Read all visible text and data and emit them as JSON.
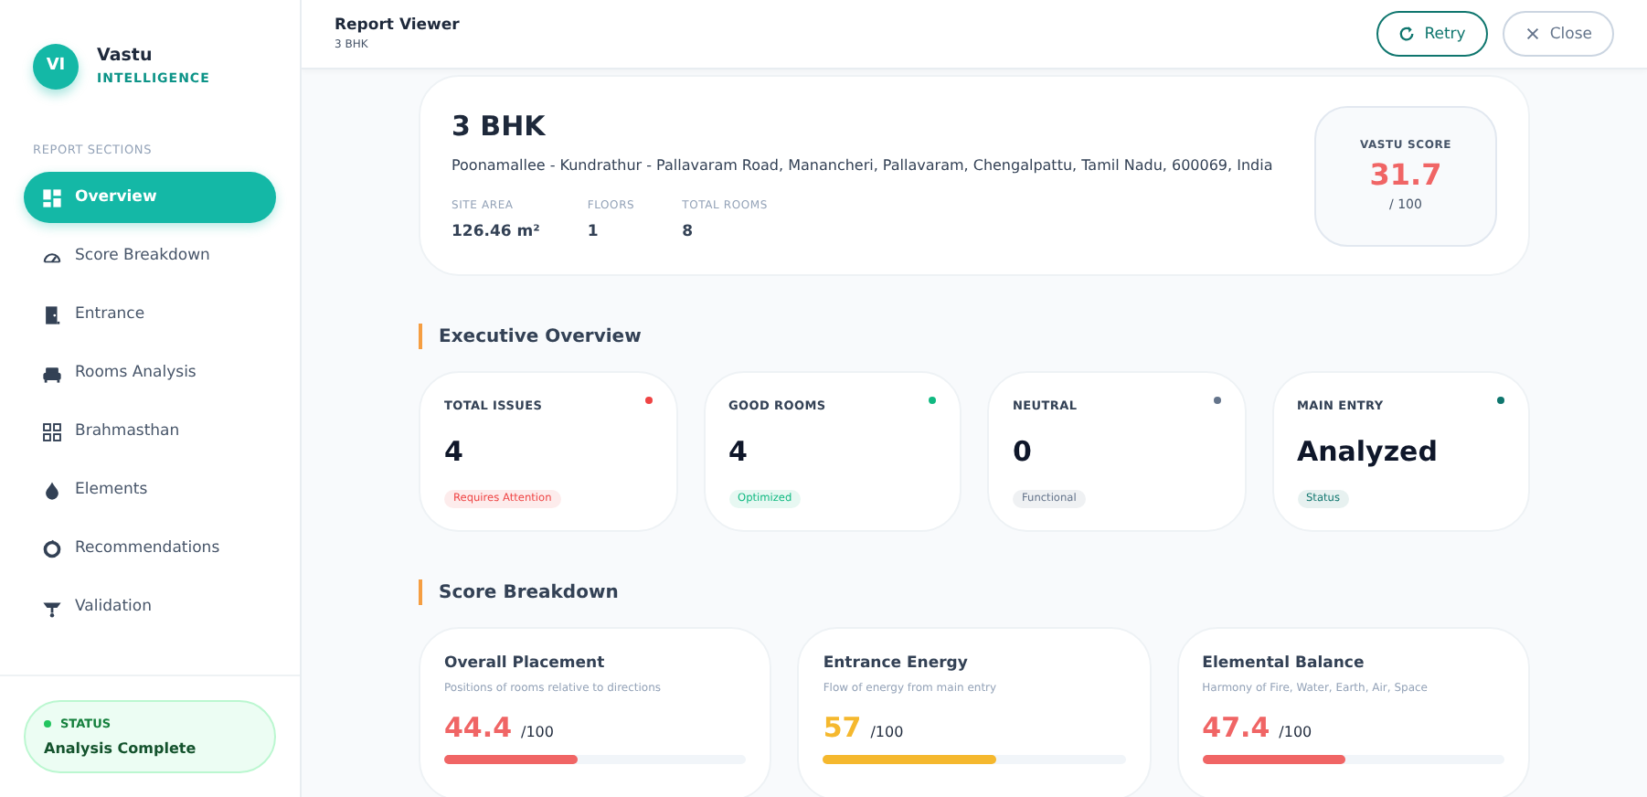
{
  "brand": {
    "initials": "VI",
    "name": "Vastu",
    "tagline": "INTELLIGENCE"
  },
  "sidebar": {
    "heading": "REPORT SECTIONS",
    "items": [
      {
        "label": "Overview",
        "selected": true
      },
      {
        "label": "Score Breakdown",
        "selected": false
      },
      {
        "label": "Entrance",
        "selected": false
      },
      {
        "label": "Rooms Analysis",
        "selected": false
      },
      {
        "label": "Brahmasthan",
        "selected": false
      },
      {
        "label": "Elements",
        "selected": false
      },
      {
        "label": "Recommendations",
        "selected": false
      },
      {
        "label": "Validation",
        "selected": false
      }
    ],
    "status": {
      "label": "STATUS",
      "value": "Analysis Complete",
      "color": "#22c55e"
    }
  },
  "header": {
    "title": "Report Viewer",
    "subtitle": "3 BHK",
    "buttons": [
      {
        "label": "Retry",
        "kind": "primary"
      },
      {
        "label": "Close",
        "kind": "secondary"
      }
    ]
  },
  "property": {
    "title": "3 BHK",
    "address": "Poonamallee - Kundrathur - Pallavaram Road, Manancheri, Pallavaram, Chengalpattu, Tamil Nadu, 600069, India",
    "facts": [
      {
        "label": "SITE AREA",
        "value": "126.46 m²"
      },
      {
        "label": "FLOORS",
        "value": "1"
      },
      {
        "label": "TOTAL ROOMS",
        "value": "8"
      }
    ],
    "score": {
      "label": "VASTU SCORE",
      "value": "31.7",
      "max": "/ 100"
    }
  },
  "executive_overview": {
    "heading": "Executive Overview",
    "cards": [
      {
        "label": "TOTAL ISSUES",
        "value": "4",
        "badge": "Requires Attention",
        "color": "#ef4444"
      },
      {
        "label": "GOOD ROOMS",
        "value": "4",
        "badge": "Optimized",
        "color": "#10b981"
      },
      {
        "label": "NEUTRAL",
        "value": "0",
        "badge": "Functional",
        "color": "#64748b"
      },
      {
        "label": "MAIN ENTRY",
        "value": "Analyzed",
        "badge": "Status",
        "color": "#0f766e"
      }
    ]
  },
  "score_breakdown": {
    "heading": "Score Breakdown",
    "cards": [
      {
        "title": "Overall Placement",
        "description": "Positions of rooms relative to directions",
        "score": "44.4",
        "max": "/100",
        "level": 0.444,
        "color": "#f06565"
      },
      {
        "title": "Entrance Energy",
        "description": "Flow of energy from main entry",
        "score": "57",
        "max": "/100",
        "level": 0.57,
        "color": "#f5b82e"
      },
      {
        "title": "Elemental Balance",
        "description": "Harmony of Fire, Water, Earth, Air, Space",
        "score": "47.4",
        "max": "/100",
        "level": 0.474,
        "color": "#f06565"
      }
    ]
  }
}
